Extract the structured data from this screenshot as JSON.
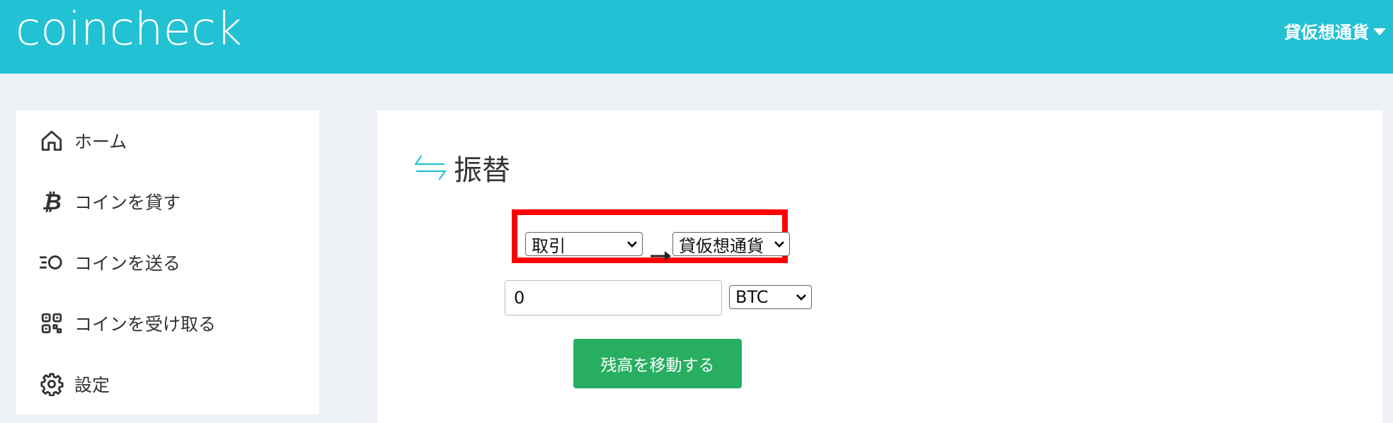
{
  "header": {
    "logo_text": "coincheck",
    "account_menu_label": "貸仮想通貨",
    "background_color": "#22c1d4"
  },
  "sidebar": {
    "items": [
      {
        "label": "ホーム",
        "icon": "home-icon"
      },
      {
        "label": "コインを貸す",
        "icon": "bitcoin-icon"
      },
      {
        "label": "コインを送る",
        "icon": "send-coin-icon"
      },
      {
        "label": "コインを受け取る",
        "icon": "qr-code-icon"
      },
      {
        "label": "設定",
        "icon": "gear-icon"
      }
    ]
  },
  "main": {
    "title": "振替",
    "title_icon": "transfer-arrows-icon",
    "from_account": "取引",
    "to_account": "貸仮想通貨",
    "amount_value": "0",
    "currency": "BTC",
    "submit_label": "残高を移動する",
    "submit_color": "#27ae60",
    "highlight_color": "#ff0000"
  }
}
